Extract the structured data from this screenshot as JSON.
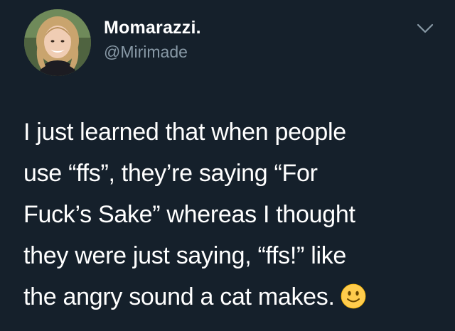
{
  "user": {
    "display_name": "Momarazzi.",
    "handle": "@Mirimade"
  },
  "tweet": {
    "lines": [
      "I just learned that when people",
      "use “ffs”, they’re saying “For",
      "Fuck’s Sake” whereas I thought",
      "they were just saying, “ffs!” like",
      "the angry sound a cat makes."
    ],
    "emoji": "slightly-smiling-face"
  },
  "icons": {
    "menu": "chevron-down-icon",
    "emoji": "slightly-smiling-face-icon"
  },
  "colors": {
    "background": "#15202b",
    "text": "#ffffff",
    "secondary_text": "#8899a6",
    "emoji_yellow": "#ffcc4d"
  }
}
